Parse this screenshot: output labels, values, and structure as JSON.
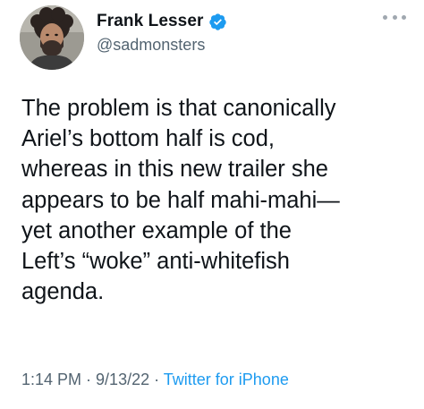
{
  "user": {
    "display_name": "Frank Lesser",
    "handle": "@sadmonsters",
    "verified_icon": "verified-badge-icon",
    "avatar_icon": "profile-photo"
  },
  "tweet": {
    "lines": [
      "The problem is that canonically",
      "Ariel’s bottom half is cod,",
      "whereas in this new trailer she",
      "appears to be half mahi-mahi—",
      "yet another example of the",
      "Left’s “woke” anti-whitefish",
      "agenda."
    ]
  },
  "meta": {
    "time": "1:14 PM",
    "sep1": " · ",
    "date": "9/13/22",
    "sep2": " · ",
    "source": "Twitter for iPhone"
  },
  "colors": {
    "text": "#0f1419",
    "muted": "#536471",
    "link": "#1d9bf0",
    "verified": "#1d9bf0"
  }
}
